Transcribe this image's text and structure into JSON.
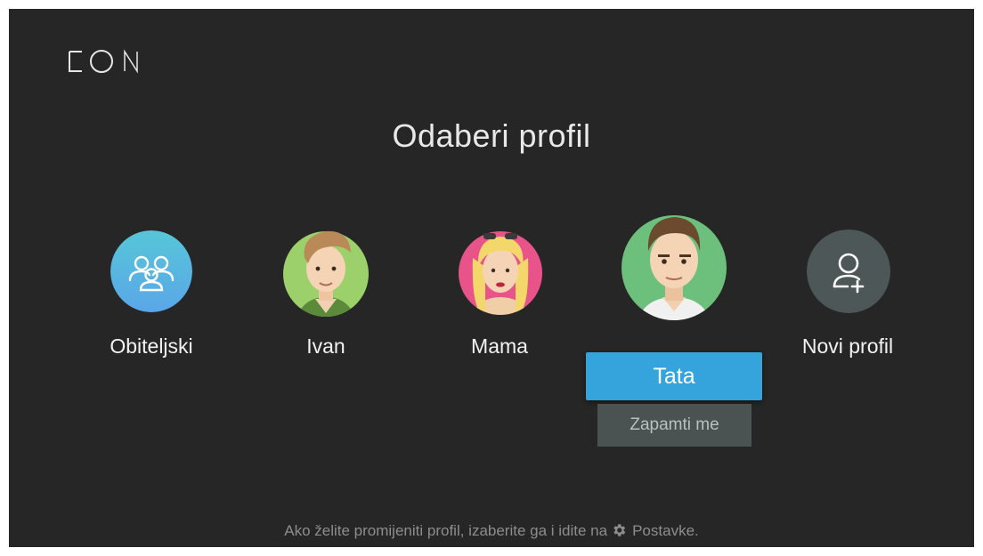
{
  "logo": {
    "text": "EON",
    "icon": "eon-logo"
  },
  "title": "Odaberi profil",
  "profiles": [
    {
      "label": "Obiteljski",
      "icon": "family-group-icon",
      "color": "#5fbfe0"
    },
    {
      "label": "Ivan",
      "icon": "avatar-ivan",
      "color": "#9bd06a"
    },
    {
      "label": "Mama",
      "icon": "avatar-mama",
      "color": "#e8548a"
    },
    {
      "label": "Tata",
      "icon": "avatar-tata",
      "color": "#6cc07c",
      "selected": true
    },
    {
      "label": "Novi profil",
      "icon": "add-user-icon",
      "color": "#4d5757"
    }
  ],
  "selected_actions": {
    "primary": "Tata",
    "secondary": "Zapamti me"
  },
  "footer": {
    "text_before": "Ako želite promijeniti profil, izaberite ga i idite na",
    "icon": "gear-icon",
    "text_after": "Postavke."
  },
  "colors": {
    "background": "#262626",
    "accent": "#35a4dc"
  }
}
